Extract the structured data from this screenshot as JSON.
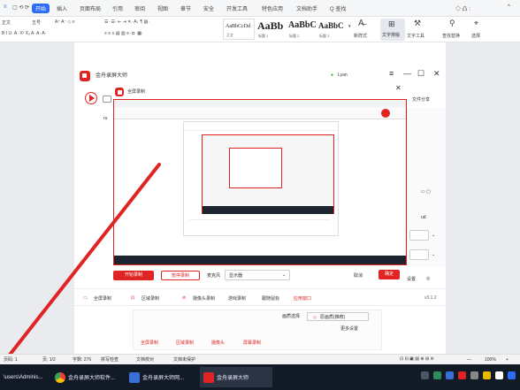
{
  "menubar": {
    "items": [
      "开始",
      "插入",
      "页面布局",
      "引用",
      "审阅",
      "视图",
      "章节",
      "安全",
      "开发工具",
      "特色应用",
      "文档助手",
      "Q 查找"
    ],
    "active_index": 0
  },
  "ribbon": {
    "font_name": "正文",
    "font_size": "五号",
    "styles": [
      {
        "sample": "AaBbCcDd",
        "label": "正文"
      },
      {
        "sample": "AaBb",
        "label": "标题 1"
      },
      {
        "sample": "AaBbC",
        "label": "标题 2"
      },
      {
        "sample": "AaBbC",
        "label": "标题 3"
      }
    ],
    "new_style": "新样式",
    "text_tools": "文字排版",
    "text_tool2": "文字工具",
    "find_replace": "查找替换",
    "select": "选择"
  },
  "recorder": {
    "app_name": "金舟录屏大师",
    "user": "Lyan",
    "subtitle": "全屏录制",
    "right_label": "文件分享",
    "start_button": "开始录制",
    "pause_button": "暂停录制",
    "dropdown1": "麦克风",
    "dropdown2": "显示器",
    "cancel": "取消",
    "confirm": "确定",
    "version": "v3.1.2",
    "settings_label": "设置",
    "tabs": [
      "全屏录制",
      "区域录制",
      "摄像头录制",
      "游戏录制",
      "跟随鼠标",
      "应用窗口"
    ],
    "bottom_items": [
      "全屏录制",
      "区域录制",
      "摄像头",
      "屏幕录制"
    ],
    "quality_label": "画质选择",
    "quality_value": "原画质(推荐)",
    "options_label": "更多设置"
  },
  "statusbar": {
    "page": "页码: 1",
    "pages": "页: 1/2",
    "words": "字数: 276",
    "spell": "拼写检查",
    "doc_check": "文档校对",
    "backup": "文档未保护",
    "zoom": "100%"
  },
  "taskbar": {
    "items": [
      {
        "label": "\\users\\Adminis...",
        "color": "#e0a800"
      },
      {
        "label": "金舟录屏大师软件...",
        "color": "#4285f4"
      },
      {
        "label": "金舟录屏大师网...",
        "color": "#3b6fd8"
      },
      {
        "label": "金舟录屏大师",
        "color": "#e02424"
      }
    ]
  },
  "colors": {
    "accent": "#2b6df5",
    "brand_red": "#e02424",
    "taskbar": "#121a26"
  }
}
